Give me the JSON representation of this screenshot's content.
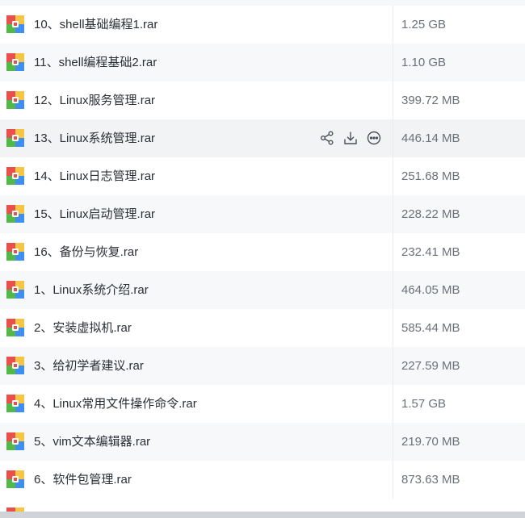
{
  "colors": {
    "icon_red": "#e9504c",
    "icon_yellow": "#f6c544",
    "icon_green": "#52b848",
    "icon_blue": "#3f8ff0"
  },
  "files": [
    {
      "name": "10、shell基础编程1.rar",
      "size": "1.25 GB"
    },
    {
      "name": "11、shell编程基础2.rar",
      "size": "1.10 GB"
    },
    {
      "name": "12、Linux服务管理.rar",
      "size": "399.72 MB"
    },
    {
      "name": "13、Linux系统管理.rar",
      "size": "446.14 MB",
      "hovered": true
    },
    {
      "name": "14、Linux日志管理.rar",
      "size": "251.68 MB"
    },
    {
      "name": "15、Linux启动管理.rar",
      "size": "228.22 MB"
    },
    {
      "name": "16、备份与恢复.rar",
      "size": "232.41 MB"
    },
    {
      "name": "1、Linux系统介绍.rar",
      "size": "464.05 MB"
    },
    {
      "name": "2、安装虚拟机.rar",
      "size": "585.44 MB"
    },
    {
      "name": "3、给初学者建议.rar",
      "size": "227.59 MB"
    },
    {
      "name": "4、Linux常用文件操作命令.rar",
      "size": "1.57 GB"
    },
    {
      "name": "5、vim文本编辑器.rar",
      "size": "219.70 MB"
    },
    {
      "name": "6、软件包管理.rar",
      "size": "873.63 MB"
    }
  ],
  "row_actions": {
    "share_icon": "share-icon",
    "download_icon": "download-icon",
    "more_icon": "more-icon"
  }
}
